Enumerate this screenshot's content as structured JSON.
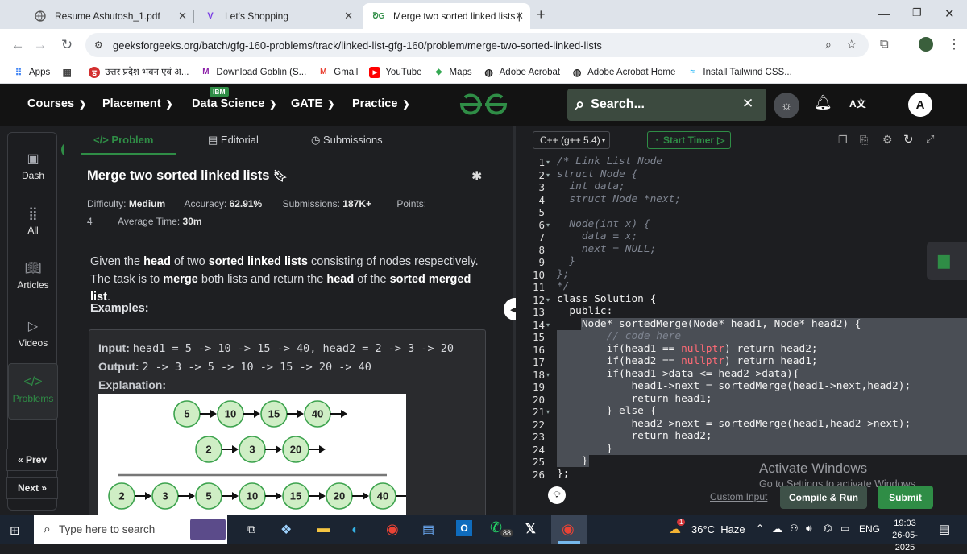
{
  "browser": {
    "tabs": [
      {
        "title": "Resume Ashutosh_1.pdf",
        "icon": "globe-icon"
      },
      {
        "title": "Let's Shopping",
        "icon": "v-logo-icon"
      },
      {
        "title": "Merge two sorted linked lists | F",
        "icon": "gfg-logo-icon"
      }
    ],
    "url": "geeksforgeeks.org/batch/gfg-160-problems/track/linked-list-gfg-160/problem/merge-two-sorted-linked-lists",
    "bookmarks": [
      {
        "label": "Apps"
      },
      {
        "label": ""
      },
      {
        "label": "उत्तर प्रदेश भवन एवं अ..."
      },
      {
        "label": "Download Goblin (S..."
      },
      {
        "label": "Gmail"
      },
      {
        "label": "YouTube"
      },
      {
        "label": "Maps"
      },
      {
        "label": "Adobe Acrobat"
      },
      {
        "label": "Adobe Acrobat Home"
      },
      {
        "label": "Install Tailwind CSS..."
      }
    ]
  },
  "site_header": {
    "menu": [
      "Courses",
      "Placement",
      "Data Science",
      "GATE",
      "Practice"
    ],
    "ibm_badge": "IBM",
    "search_label": "Search...",
    "avatar_letter": "A",
    "brand_color": "#2f8d46"
  },
  "sidebar": {
    "items": [
      {
        "label": "Dash",
        "icon": "dashboard-icon"
      },
      {
        "label": "All",
        "icon": "grid-icon"
      },
      {
        "label": "Articles",
        "icon": "book-icon"
      },
      {
        "label": "Videos",
        "icon": "video-icon"
      },
      {
        "label": "Problems",
        "icon": "code-icon"
      }
    ],
    "prev_label": "« Prev",
    "next_label": "Next »"
  },
  "problem": {
    "tabs": [
      "</> Problem",
      "Editorial",
      "Submissions"
    ],
    "title": "Merge two sorted linked lists",
    "difficulty_label": "Difficulty:",
    "difficulty": "Medium",
    "accuracy_label": "Accuracy:",
    "accuracy": "62.91%",
    "submissions_label": "Submissions:",
    "submissions": "187K+",
    "points_label": "Points:",
    "points": "4",
    "avg_time_label": "Average Time:",
    "avg_time": "30m",
    "desc_parts": [
      "Given the ",
      "head",
      " of two ",
      "sorted linked lists",
      " consisting of nodes respectively. The task is to ",
      "merge",
      " both lists and return the ",
      "head",
      " of the ",
      "sorted merged list",
      "."
    ],
    "examples_heading": "Examples:",
    "input_label": "Input:",
    "input_value": "head1 = 5 -> 10 -> 15 -> 40, head2 = 2 -> 3 -> 20",
    "output_label": "Output:",
    "output_value": "2 -> 3 -> 5 -> 10 -> 15 -> 20 -> 40",
    "explanation_label": "Explanation:",
    "diagram": {
      "list1": [
        "5",
        "10",
        "15",
        "40"
      ],
      "list2": [
        "2",
        "3",
        "20"
      ],
      "merged": [
        "2",
        "3",
        "5",
        "10",
        "15",
        "20",
        "40"
      ]
    }
  },
  "editor": {
    "language": "C++ (g++ 5.4)",
    "start_timer": "Start Timer",
    "lines": [
      {
        "n": "1",
        "text": "/* Link List Node",
        "cls": "cm",
        "fold": true
      },
      {
        "n": "2",
        "text": "struct Node {",
        "cls": "cm",
        "fold": true
      },
      {
        "n": "3",
        "text": "  int data;",
        "cls": "cm"
      },
      {
        "n": "4",
        "text": "  struct Node *next;",
        "cls": "cm"
      },
      {
        "n": "5",
        "text": "",
        "cls": "cm"
      },
      {
        "n": "6",
        "text": "  Node(int x) {",
        "cls": "cm",
        "fold": true
      },
      {
        "n": "7",
        "text": "    data = x;",
        "cls": "cm"
      },
      {
        "n": "8",
        "text": "    next = NULL;",
        "cls": "cm"
      },
      {
        "n": "9",
        "text": "  }",
        "cls": "cm"
      },
      {
        "n": "10",
        "text": "};",
        "cls": "cm"
      },
      {
        "n": "11",
        "text": "*/",
        "cls": "cm"
      },
      {
        "n": "12",
        "text": "class Solution {",
        "cls": "",
        "fold": true
      },
      {
        "n": "13",
        "text": "  public:",
        "cls": ""
      },
      {
        "n": "14",
        "text": "    Node* sortedMerge(Node* head1, Node* head2) {",
        "cls": "",
        "fold": true
      },
      {
        "n": "15",
        "text": "        // code here",
        "cls": "cm"
      },
      {
        "n": "16",
        "text": "        if(head1 == nullptr) return head2;",
        "cls": ""
      },
      {
        "n": "17",
        "text": "        if(head2 == nullptr) return head1;",
        "cls": ""
      },
      {
        "n": "18",
        "text": "        if(head1->data <= head2->data){",
        "cls": "",
        "fold": true
      },
      {
        "n": "19",
        "text": "            head1->next = sortedMerge(head1->next,head2);",
        "cls": ""
      },
      {
        "n": "20",
        "text": "            return head1;",
        "cls": ""
      },
      {
        "n": "21",
        "text": "        } else {",
        "cls": "",
        "fold": true
      },
      {
        "n": "22",
        "text": "            head2->next = sortedMerge(head1,head2->next);",
        "cls": ""
      },
      {
        "n": "23",
        "text": "            return head2;",
        "cls": ""
      },
      {
        "n": "24",
        "text": "        }",
        "cls": ""
      },
      {
        "n": "25",
        "text": "    }",
        "cls": ""
      },
      {
        "n": "26",
        "text": "};",
        "cls": ""
      }
    ],
    "custom_input": "Custom Input",
    "compile_run": "Compile & Run",
    "submit": "Submit",
    "watermark_title": "Activate Windows",
    "watermark_sub": "Go to Settings to activate Windows."
  },
  "taskbar": {
    "search_placeholder": "Type here to search",
    "whatsapp_badge": "88",
    "weather": "36°C  Haze",
    "weather_badge": "1",
    "lang": "ENG",
    "time": "19:03",
    "date": "26-05-2025"
  }
}
